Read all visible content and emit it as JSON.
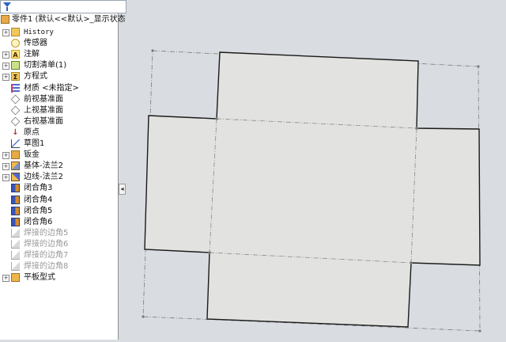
{
  "tree": {
    "root_label": "零件1 (默认<<默认>_显示状态",
    "items": [
      {
        "label": "History",
        "icon": "history-folder-icon",
        "expandable": true,
        "mono": true,
        "muted": false
      },
      {
        "label": "传感器",
        "icon": "sensor-icon",
        "expandable": false,
        "mono": false,
        "muted": false
      },
      {
        "label": "注解",
        "icon": "annotation-icon",
        "expandable": true,
        "mono": false,
        "muted": false
      },
      {
        "label": "切割清单(1)",
        "icon": "cut-list-icon",
        "expandable": true,
        "mono": false,
        "muted": false
      },
      {
        "label": "方程式",
        "icon": "equation-icon",
        "expandable": true,
        "mono": false,
        "muted": false
      },
      {
        "label": "材质 <未指定>",
        "icon": "material-icon",
        "expandable": false,
        "mono": false,
        "muted": false
      },
      {
        "label": "前视基准面",
        "icon": "plane-icon",
        "expandable": false,
        "mono": false,
        "muted": false
      },
      {
        "label": "上视基准面",
        "icon": "plane-icon",
        "expandable": false,
        "mono": false,
        "muted": false
      },
      {
        "label": "右视基准面",
        "icon": "plane-icon",
        "expandable": false,
        "mono": false,
        "muted": false
      },
      {
        "label": "原点",
        "icon": "origin-icon",
        "expandable": false,
        "mono": false,
        "muted": false
      },
      {
        "label": "草图1",
        "icon": "sketch-icon",
        "expandable": false,
        "mono": false,
        "muted": false
      },
      {
        "label": "钣金",
        "icon": "sheet-metal-icon",
        "expandable": true,
        "mono": false,
        "muted": false
      },
      {
        "label": "基体-法兰2",
        "icon": "base-flange-icon",
        "expandable": true,
        "mono": false,
        "muted": false
      },
      {
        "label": "边线-法兰2",
        "icon": "edge-flange-icon",
        "expandable": true,
        "mono": false,
        "muted": false
      },
      {
        "label": "闭合角3",
        "icon": "closed-corner-icon",
        "expandable": false,
        "mono": false,
        "muted": false
      },
      {
        "label": "闭合角4",
        "icon": "closed-corner-icon",
        "expandable": false,
        "mono": false,
        "muted": false
      },
      {
        "label": "闭合角5",
        "icon": "closed-corner-icon",
        "expandable": false,
        "mono": false,
        "muted": false
      },
      {
        "label": "闭合角6",
        "icon": "closed-corner-icon",
        "expandable": false,
        "mono": false,
        "muted": false
      },
      {
        "label": "焊接的边角5",
        "icon": "welded-corner-icon",
        "expandable": false,
        "mono": false,
        "muted": true
      },
      {
        "label": "焊接的边角6",
        "icon": "welded-corner-icon",
        "expandable": false,
        "mono": false,
        "muted": true
      },
      {
        "label": "焊接的边角7",
        "icon": "welded-corner-icon",
        "expandable": false,
        "mono": false,
        "muted": true
      },
      {
        "label": "焊接的边角8",
        "icon": "welded-corner-icon",
        "expandable": false,
        "mono": false,
        "muted": true
      },
      {
        "label": "平板型式",
        "icon": "flat-pattern-icon",
        "expandable": true,
        "mono": false,
        "muted": false
      }
    ]
  },
  "glyphs": {
    "expand": "+",
    "collapse_arrow": "◂",
    "annotation": "A",
    "equation": "Σ",
    "origin": "↓"
  },
  "colors": {
    "viewport_bg": "#d9dde2",
    "sheet_face": "#e2e2e0",
    "edge_line": "#1a1a1a",
    "bend_line": "#8a8a8a",
    "vertex": "#7a7a7a"
  }
}
